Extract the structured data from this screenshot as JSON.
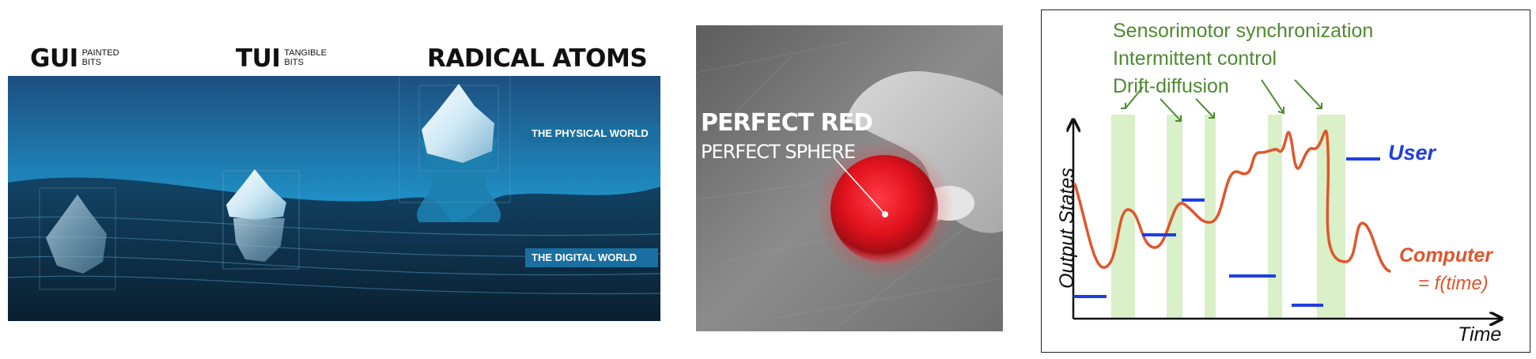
{
  "left_panel": {
    "gui": {
      "big": "GUI",
      "small_1": "PAINTED",
      "small_2": "BITS"
    },
    "tui": {
      "big": "TUI",
      "small_1": "TANGIBLE",
      "small_2": "BITS"
    },
    "radical_atoms": "RADICAL ATOMS",
    "physical_world": "THE PHYSICAL WORLD",
    "digital_world": "THE DIGITAL WORLD",
    "colors": {
      "sky": "#1e6fa6",
      "sea": "#0d2a40",
      "band": "#1a6fa0"
    }
  },
  "middle_panel": {
    "title": "PERFECT RED",
    "subtitle": "PERFECT SPHERE",
    "colors": {
      "sphere": "#e0121c"
    }
  },
  "right_panel": {
    "labels": [
      "Sensorimotor synchronization",
      "Intermittent control",
      "Drift-diffusion"
    ],
    "ylabel": "Output States",
    "xlabel": "Time",
    "user_label": "User",
    "computer_label": "Computer",
    "computer_eq": "= f(time)",
    "colors": {
      "user": "#1e3fe0",
      "computer": "#e0562c",
      "band": "#daf0c8",
      "label": "#4e8a32"
    }
  }
}
